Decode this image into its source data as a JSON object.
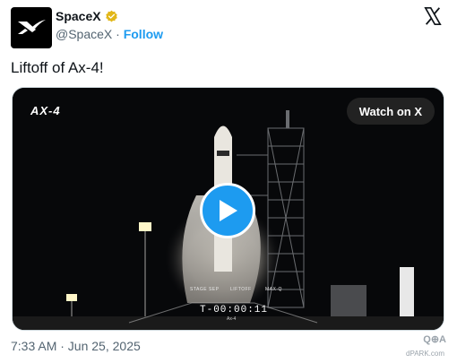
{
  "author": {
    "display_name": "SpaceX",
    "handle": "@SpaceX",
    "separator": " · ",
    "follow_label": "Follow",
    "verified_icon": "verified-badge-icon"
  },
  "tweet": {
    "text": "Liftoff of Ax-4!",
    "timestamp": "7:33 AM · Jun 25, 2025"
  },
  "media": {
    "mission_logo": "AX-4",
    "watch_label": "Watch on X",
    "clock": "T-00:00:11",
    "clock_sub": "Ax-4",
    "hud_labels": [
      "STAGE SEP",
      "LIFTOFF",
      "MAX-Q"
    ]
  },
  "watermark": {
    "main": "Q⊕A",
    "sub": "dPARK.com"
  },
  "colors": {
    "accent": "#1d9bf0",
    "text": "#0f1419",
    "muted": "#536471"
  }
}
